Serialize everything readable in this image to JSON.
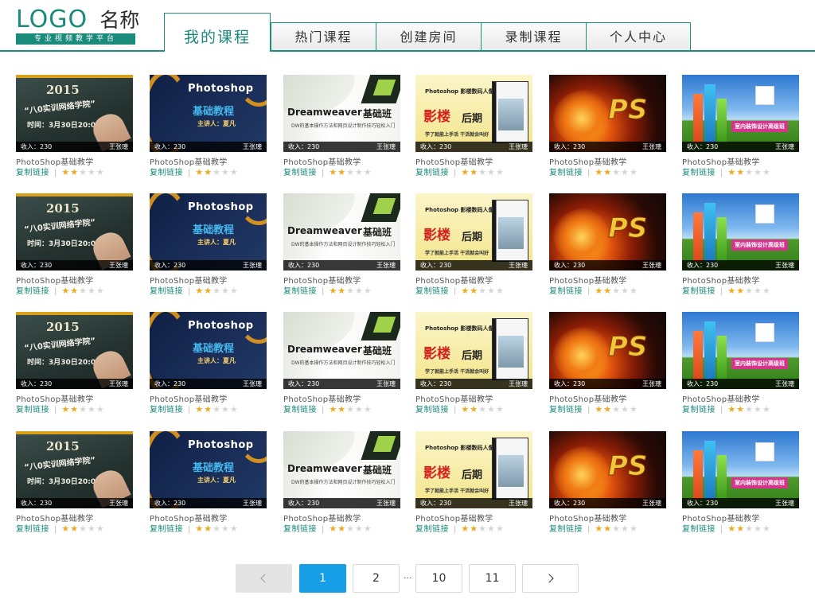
{
  "header": {
    "logo_text": "LOGO",
    "logo_name": "名称",
    "logo_tagline": "专业视频教学平台",
    "tabs": [
      {
        "label": "我的课程",
        "active": true
      },
      {
        "label": "热门课程",
        "active": false
      },
      {
        "label": "创建房间",
        "active": false
      },
      {
        "label": "录制课程",
        "active": false
      },
      {
        "label": "个人中心",
        "active": false
      }
    ]
  },
  "theme": {
    "accent": "#1a8a7a",
    "pager_current": "#169fe6",
    "star_on": "#f0a91c",
    "star_off": "#d6d6d6"
  },
  "course_card": {
    "title": "PhotoShop基础教学",
    "income": "收入：230",
    "teacher": "王张璁",
    "copy_link": "复制链接",
    "separator": "|",
    "rating": 2,
    "rating_max": 5
  },
  "thumbnails": [
    {
      "icon": "chalkboard-2015-thumbnail",
      "lines": [
        "2015",
        "“八0实训网络学院”",
        "时间：3月30日20:00"
      ]
    },
    {
      "icon": "photoshop-basics-thumbnail",
      "lines": [
        "Photoshop",
        "基础教程",
        "主讲人：夏凡"
      ]
    },
    {
      "icon": "dreamweaver-class-thumbnail",
      "lines": [
        "Dreamweaver",
        "基础班",
        "DW的基本操作方法和网页设计制作技巧轻松入门"
      ]
    },
    {
      "icon": "photoshop-portrait-thumbnail",
      "lines": [
        "Photoshop 影楼数码人像",
        "影楼",
        "后期",
        "学了就能上手活 干活就会叫好"
      ]
    },
    {
      "icon": "fire-ps-thumbnail",
      "lines": [
        "PS"
      ]
    },
    {
      "icon": "interior-design-thumbnail",
      "lines": [
        "室内装饰设计高级班"
      ]
    }
  ],
  "grid": {
    "rows": 4,
    "columns": 6
  },
  "pagination": {
    "prev_label": "‹",
    "pages": [
      "1",
      "2"
    ],
    "ellipsis": "...",
    "tail_pages": [
      "10",
      "11"
    ],
    "current": "1",
    "next_label": "›"
  }
}
